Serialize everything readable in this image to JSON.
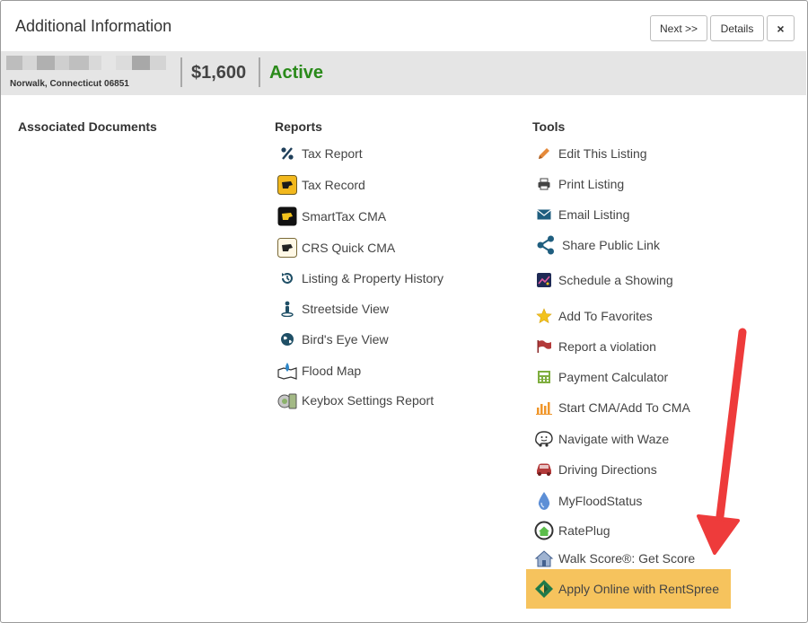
{
  "dialog": {
    "title": "Additional Information",
    "next_label": "Next >>",
    "details_label": "Details",
    "close_label": "×"
  },
  "listing": {
    "address": "Norwalk, Connecticut 06851",
    "price": "$1,600",
    "status": "Active",
    "status_color": "#2a8a1a"
  },
  "columns": {
    "documents": {
      "title": "Associated Documents"
    },
    "reports": {
      "title": "Reports",
      "items": [
        {
          "label": "Tax Report",
          "icon": "percent-icon"
        },
        {
          "label": "Tax Record",
          "icon": "connecticut-map-icon"
        },
        {
          "label": "SmartTax CMA",
          "icon": "connecticut-map-dark-icon"
        },
        {
          "label": "CRS Quick CMA",
          "icon": "connecticut-outline-icon"
        },
        {
          "label": "Listing & Property History",
          "icon": "history-icon"
        },
        {
          "label": "Streetside View",
          "icon": "street-person-icon"
        },
        {
          "label": "Bird's Eye View",
          "icon": "globe-icon"
        },
        {
          "label": "Flood Map",
          "icon": "flood-map-icon"
        },
        {
          "label": "Keybox Settings Report",
          "icon": "keybox-icon"
        }
      ]
    },
    "tools": {
      "title": "Tools",
      "items": [
        {
          "label": "Edit This Listing",
          "icon": "pencil-icon"
        },
        {
          "label": "Print Listing",
          "icon": "printer-icon"
        },
        {
          "label": "Email Listing",
          "icon": "envelope-icon"
        },
        {
          "label": "Share Public Link",
          "icon": "share-icon"
        },
        {
          "label": "Schedule a Showing",
          "icon": "calendar-icon"
        },
        {
          "label": "Add To Favorites",
          "icon": "star-icon"
        },
        {
          "label": "Report a violation",
          "icon": "flag-icon"
        },
        {
          "label": "Payment Calculator",
          "icon": "calculator-icon"
        },
        {
          "label": "Start CMA/Add To CMA",
          "icon": "bar-chart-icon"
        },
        {
          "label": "Navigate with Waze",
          "icon": "waze-icon"
        },
        {
          "label": "Driving Directions",
          "icon": "car-icon"
        },
        {
          "label": "MyFloodStatus",
          "icon": "water-drop-icon"
        },
        {
          "label": "RatePlug",
          "icon": "rateplug-icon"
        },
        {
          "label": "Walk Score®: Get Score",
          "icon": "walkscore-house-icon"
        },
        {
          "label": "Apply Online with RentSpree",
          "icon": "rentspree-icon"
        }
      ]
    }
  },
  "colors": {
    "highlight": "#f6c35d",
    "annotation_arrow": "#ee3b3b"
  }
}
